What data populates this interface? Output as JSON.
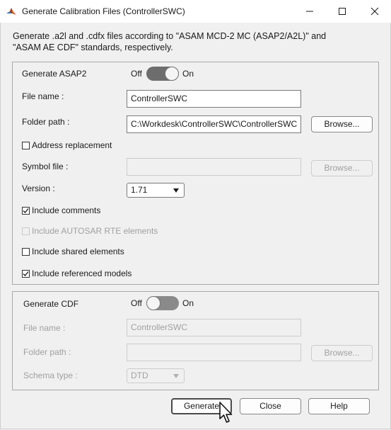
{
  "window": {
    "title": "Generate Calibration Files (ControllerSWC)"
  },
  "description": {
    "line1": "Generate .a2l and .cdfx files according to \"ASAM MCD-2 MC (ASAP2/A2L)\" and",
    "line2": "\"ASAM AE CDF\" standards, respectively."
  },
  "asap2": {
    "header": "Generate ASAP2",
    "toggle_off": "Off",
    "toggle_on": "On",
    "file_name_label": "File name :",
    "file_name_value": "ControllerSWC",
    "folder_path_label": "Folder path :",
    "folder_path_value": "C:\\Workdesk\\ControllerSWC\\ControllerSWC",
    "browse_label": "Browse...",
    "address_replacement_label": "Address replacement",
    "symbol_file_label": "Symbol file :",
    "symbol_file_value": "",
    "symbol_browse_label": "Browse...",
    "version_label": "Version :",
    "version_value": "1.71",
    "include_comments_label": "Include comments",
    "include_autosar_label": "Include AUTOSAR RTE elements",
    "include_shared_label": "Include shared elements",
    "include_referenced_label": "Include referenced models"
  },
  "cdf": {
    "header": "Generate CDF",
    "toggle_off": "Off",
    "toggle_on": "On",
    "file_name_label": "File name :",
    "file_name_value": "ControllerSWC",
    "folder_path_label": "Folder path :",
    "folder_path_value": "",
    "browse_label": "Browse...",
    "schema_type_label": "Schema type :",
    "schema_type_value": "DTD"
  },
  "footer": {
    "generate_label": "Generate",
    "close_label": "Close",
    "help_label": "Help"
  },
  "colors": {
    "accent_toggle": "#6d6d6d",
    "disabled_text": "#a0a0a0",
    "matlab_icon": "#d95319"
  }
}
